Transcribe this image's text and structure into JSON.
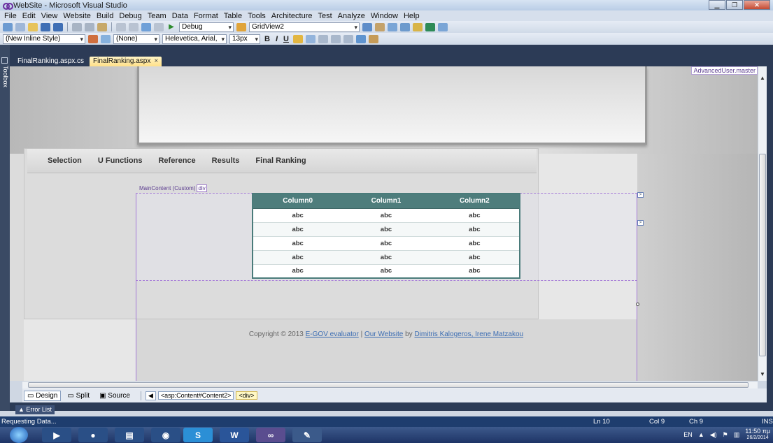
{
  "window": {
    "title": "WebSite - Microsoft Visual Studio"
  },
  "menu": [
    "File",
    "Edit",
    "View",
    "Website",
    "Build",
    "Debug",
    "Team",
    "Data",
    "Format",
    "Table",
    "Tools",
    "Architecture",
    "Test",
    "Analyze",
    "Window",
    "Help"
  ],
  "toolbar1": {
    "config": "Debug",
    "find_target": "GridView2"
  },
  "toolbar2": {
    "style": "(New Inline Style)",
    "target_rule": "(None)",
    "font": "Helevetica, Arial,",
    "size": "13px",
    "bold": "B",
    "italic": "I",
    "underline": "U"
  },
  "toolbox": {
    "label": "Toolbox"
  },
  "tabs": [
    {
      "label": "FinalRanking.aspx.cs"
    },
    {
      "label": "FinalRanking.aspx",
      "close": "×"
    }
  ],
  "designer": {
    "master_tag": "AdvancedUser.master",
    "nav": [
      "Selection",
      "U Functions",
      "Reference",
      "Results",
      "Final Ranking"
    ],
    "content_label": "MainContent (Custom)",
    "div_tag": "div",
    "grid": {
      "columns": [
        "Column0",
        "Column1",
        "Column2"
      ],
      "rows": [
        [
          "abc",
          "abc",
          "abc"
        ],
        [
          "abc",
          "abc",
          "abc"
        ],
        [
          "abc",
          "abc",
          "abc"
        ],
        [
          "abc",
          "abc",
          "abc"
        ],
        [
          "abc",
          "abc",
          "abc"
        ]
      ]
    },
    "footer": {
      "prefix": "Copyright © 2013 ",
      "link1": "E-GOV evaluator",
      "sep": " | ",
      "link2": "Our Website",
      "by": " by ",
      "link3": "Dimitris Kalogeros, Irene Matzakou"
    }
  },
  "viewbar": {
    "design": "Design",
    "split": "Split",
    "source": "Source",
    "crumb1": "<asp:Content#Content2>",
    "crumb2": "<div>"
  },
  "error_list": "Error List",
  "status": {
    "message": "Requesting Data...",
    "ln": "Ln 10",
    "col": "Col 9",
    "ch": "Ch 9",
    "mode": "INS"
  },
  "tray": {
    "lang": "EN",
    "time": "11:50 πμ",
    "date": "26/2/2014"
  },
  "colors": {
    "grid_header": "#4e7d7c",
    "status_bar": "#1e3d6e",
    "active_tab": "#ffe08a"
  }
}
